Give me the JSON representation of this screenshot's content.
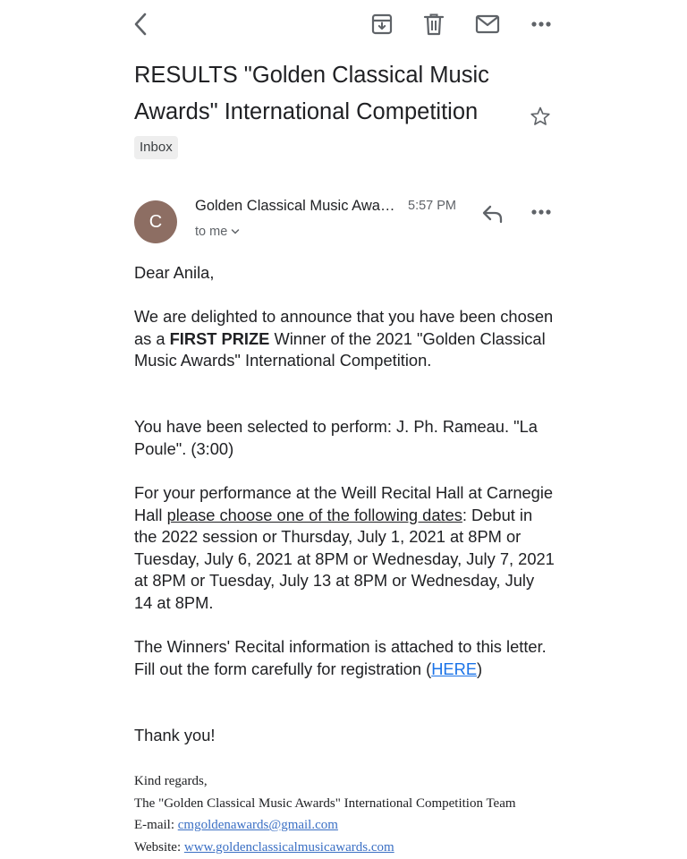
{
  "toolbar": {
    "back_icon": "back-arrow-icon",
    "archive_icon": "archive-icon",
    "delete_icon": "trash-icon",
    "mark_unread_icon": "mail-icon",
    "more_icon": "more-horizontal-icon"
  },
  "email": {
    "subject": "RESULTS \"Golden Classical Music Awards\" International Competition",
    "label": "Inbox",
    "avatar_letter": "C",
    "avatar_color": "#8d6e63",
    "sender": "Golden Classical Music Awards",
    "time": "5:57 PM",
    "recipient": "to me"
  },
  "body": {
    "greeting": "Dear Anila,",
    "p1_before": "We are delighted to announce that you have been chosen as a ",
    "p1_bold": "FIRST PRIZE",
    "p1_after": " Winner of the 2021 \"Golden Classical Music Awards\" International Competition.",
    "p2": "You have been selected to perform: J. Ph. Rameau. \"La Poule\". (3:00)",
    "p3_before": "For your performance at the Weill Recital Hall at Carnegie Hall ",
    "p3_underline": "please choose one of the following dates",
    "p3_after": ": Debut in the 2022 session or Thursday, July 1, 2021 at 8PM or Tuesday, July 6, 2021 at 8PM or Wednesday, July 7, 2021 at 8PM or Tuesday, July 13 at 8PM or Wednesday, July 14 at 8PM.",
    "p4_line1": "The Winners' Recital information is attached to this letter.",
    "p4_line2_before": "Fill out the form carefully for registration (",
    "p4_link": "HERE",
    "p4_line2_after": ")",
    "thanks": "Thank you!"
  },
  "signature": {
    "regards": "Kind regards,",
    "team": "The \"Golden Classical Music Awards\" International Competition Team",
    "email_label": "E-mail: ",
    "email": "cmgoldenawards@gmail.com",
    "website_label": "Website: ",
    "website": "www.goldenclassicalmusicawards.com"
  },
  "colors": {
    "link": "#1a73e8",
    "icon": "#5f6368"
  }
}
